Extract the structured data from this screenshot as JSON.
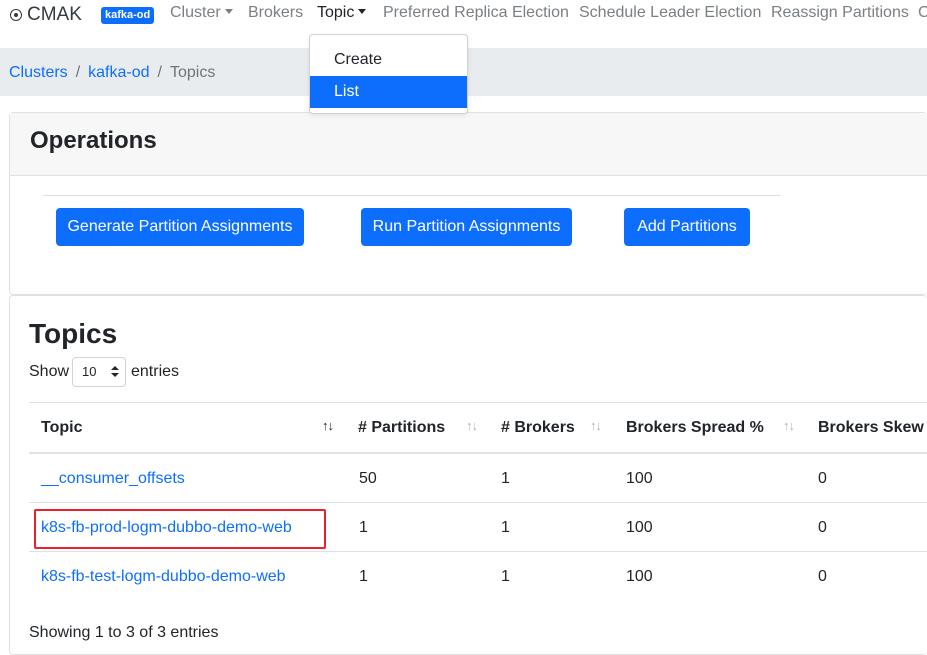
{
  "navbar": {
    "brand": "CMAK",
    "cluster_badge": "kafka-od",
    "items": [
      {
        "label": "Cluster"
      },
      {
        "label": "Brokers"
      },
      {
        "label": "Topic"
      },
      {
        "label": "Preferred Replica Election"
      },
      {
        "label": "Schedule Leader Election"
      },
      {
        "label": "Reassign Partitions"
      },
      {
        "label": "C"
      }
    ],
    "topic_dropdown": [
      {
        "label": "Create"
      },
      {
        "label": "List"
      }
    ]
  },
  "breadcrumb": {
    "items": [
      {
        "label": "Clusters"
      },
      {
        "label": "kafka-od"
      },
      {
        "label": "Topics"
      }
    ],
    "separator": "/"
  },
  "operations": {
    "title": "Operations",
    "buttons": [
      {
        "label": "Generate Partition Assignments"
      },
      {
        "label": "Run Partition Assignments"
      },
      {
        "label": "Add Partitions"
      }
    ]
  },
  "topics": {
    "title": "Topics",
    "show_label": "Show",
    "entries_label": "entries",
    "page_size": "10",
    "columns": [
      {
        "label": "Topic"
      },
      {
        "label": "# Partitions"
      },
      {
        "label": "# Brokers"
      },
      {
        "label": "Brokers Spread %"
      },
      {
        "label": "Brokers Skew %"
      }
    ],
    "rows": [
      {
        "topic": "__consumer_offsets",
        "partitions": "50",
        "brokers": "1",
        "spread": "100",
        "skew": "0"
      },
      {
        "topic": "k8s-fb-prod-logm-dubbo-demo-web",
        "partitions": "1",
        "brokers": "1",
        "spread": "100",
        "skew": "0"
      },
      {
        "topic": "k8s-fb-test-logm-dubbo-demo-web",
        "partitions": "1",
        "brokers": "1",
        "spread": "100",
        "skew": "0"
      }
    ],
    "footer": "Showing 1 to 3 of 3 entries"
  },
  "colors": {
    "primary": "#0d6efd",
    "highlight": "#e8212b",
    "breadcrumb_bg": "#e9ecef"
  }
}
